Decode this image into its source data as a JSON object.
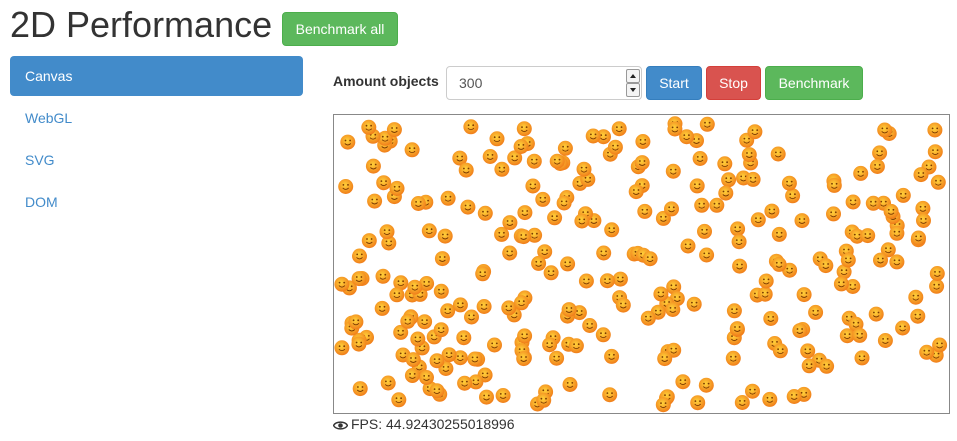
{
  "header": {
    "title": "2D Performance",
    "benchmark_all_label": "Benchmark all"
  },
  "nav": {
    "items": [
      {
        "label": "Canvas",
        "active": true
      },
      {
        "label": "WebGL",
        "active": false
      },
      {
        "label": "SVG",
        "active": false
      },
      {
        "label": "DOM",
        "active": false
      }
    ]
  },
  "controls": {
    "amount_label": "Amount objects",
    "amount_value": "300",
    "start_label": "Start",
    "stop_label": "Stop",
    "benchmark_label": "Benchmark"
  },
  "stage": {
    "object_count": 300,
    "sprite_icon": "smiley-face-icon",
    "sprite_colors": {
      "outer": "#f07d1a",
      "inner": "#ffd23a",
      "face": "#7a3a00"
    }
  },
  "status": {
    "fps_text": "FPS: 44.92430255018996",
    "fps_icon": "eye-icon"
  },
  "colors": {
    "primary": "#428bca",
    "success": "#5cb85c",
    "danger": "#d9534f"
  }
}
